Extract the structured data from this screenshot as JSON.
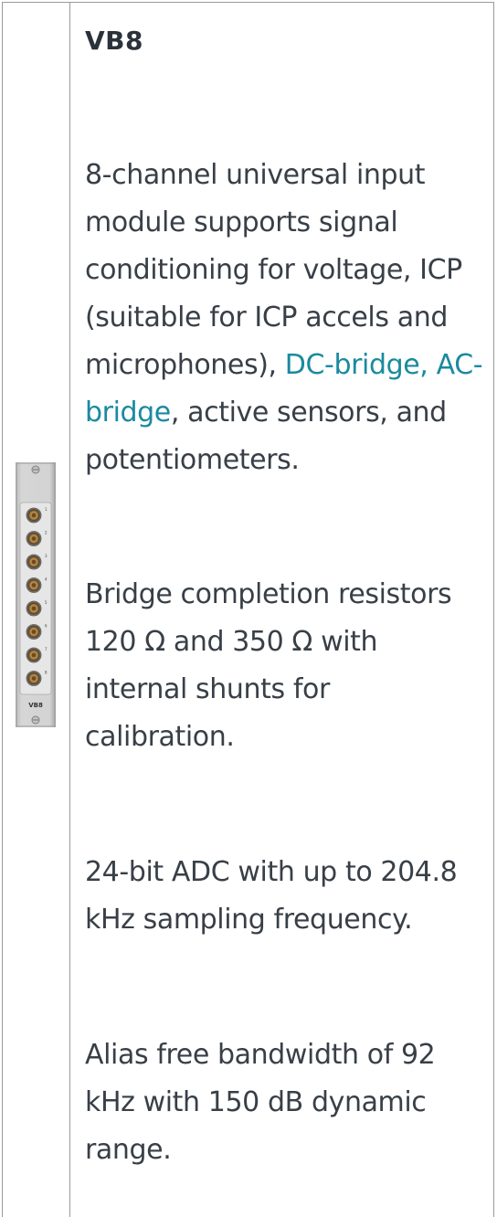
{
  "module": {
    "title": "VB8",
    "image_label": "VB8",
    "channel_numbers": [
      "1",
      "2",
      "3",
      "4",
      "5",
      "6",
      "7",
      "8"
    ]
  },
  "paragraphs": {
    "p1": {
      "before": "8-channel universal input module supports signal conditioning for voltage, ICP (suitable for ICP accels and microphones), ",
      "link1": "DC-bridge,",
      "between": " ",
      "link2": "AC-bridge",
      "after": ", active sensors, and potentiometers."
    },
    "p2": "Bridge completion resistors 120 Ω and 350 Ω with internal shunts for calibration.",
    "p3": "24-bit ADC with up to 204.8 kHz sampling frequency.",
    "p4": "Alias free bandwidth of 92 kHz with 150 dB dynamic range."
  },
  "colors": {
    "link": "#1a8a9f",
    "text": "#383f47",
    "border": "#9a9a9a"
  }
}
